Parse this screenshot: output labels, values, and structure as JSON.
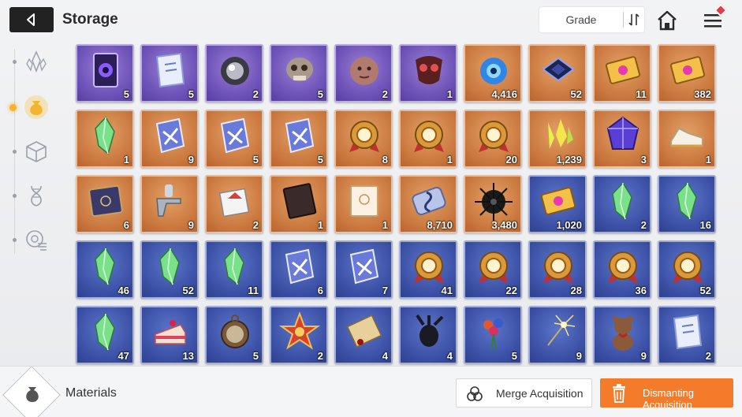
{
  "header": {
    "title": "Storage",
    "sort_label": "Grade"
  },
  "sidebar": {
    "items": [
      {
        "icon": "crystal-icon",
        "active": false
      },
      {
        "icon": "pouch-icon",
        "active": true
      },
      {
        "icon": "cube-icon",
        "active": false
      },
      {
        "icon": "dna-icon",
        "active": false
      },
      {
        "icon": "disc-icon",
        "active": false
      }
    ]
  },
  "colors": {
    "purple_rarity": "#6a4fb5",
    "orange_rarity": "#c9773d",
    "blue_rarity": "#3a4fa3",
    "dismantle_button": "#f47b29",
    "badge": "#e53b47"
  },
  "items": [
    {
      "rarity": "purple",
      "icon": "card-icon",
      "qty": "5"
    },
    {
      "rarity": "purple",
      "icon": "book-icon",
      "qty": "5"
    },
    {
      "rarity": "purple",
      "icon": "orb-icon",
      "qty": "2"
    },
    {
      "rarity": "purple",
      "icon": "skull-icon",
      "qty": "5"
    },
    {
      "rarity": "purple",
      "icon": "head-icon",
      "qty": "2"
    },
    {
      "rarity": "purple",
      "icon": "mask-icon",
      "qty": "1"
    },
    {
      "rarity": "orange",
      "icon": "blue-core-icon",
      "qty": "4,416"
    },
    {
      "rarity": "orange",
      "icon": "chip-icon",
      "qty": "52"
    },
    {
      "rarity": "orange",
      "icon": "ticket-icon",
      "qty": "11"
    },
    {
      "rarity": "orange",
      "icon": "ticket-icon",
      "qty": "382"
    },
    {
      "rarity": "orange",
      "icon": "crystal-icon",
      "qty": "1"
    },
    {
      "rarity": "orange",
      "icon": "manual-icon",
      "qty": "9"
    },
    {
      "rarity": "orange",
      "icon": "manual-icon",
      "qty": "5"
    },
    {
      "rarity": "orange",
      "icon": "manual-icon",
      "qty": "5"
    },
    {
      "rarity": "orange",
      "icon": "medal-icon",
      "qty": "8"
    },
    {
      "rarity": "orange",
      "icon": "medal-icon",
      "qty": "1"
    },
    {
      "rarity": "orange",
      "icon": "medal-icon",
      "qty": "20"
    },
    {
      "rarity": "orange",
      "icon": "shard-icon",
      "qty": "1,239"
    },
    {
      "rarity": "orange",
      "icon": "cube-gem-icon",
      "qty": "3"
    },
    {
      "rarity": "orange",
      "icon": "sneaker-icon",
      "qty": "1"
    },
    {
      "rarity": "orange",
      "icon": "tome-icon",
      "qty": "6"
    },
    {
      "rarity": "orange",
      "icon": "spray-gun-icon",
      "qty": "9"
    },
    {
      "rarity": "orange",
      "icon": "papers-icon",
      "qty": "2"
    },
    {
      "rarity": "orange",
      "icon": "ledger-icon",
      "qty": "1"
    },
    {
      "rarity": "orange",
      "icon": "notebook-icon",
      "qty": "1"
    },
    {
      "rarity": "orange",
      "icon": "music-scroll-icon",
      "qty": "8,710"
    },
    {
      "rarity": "orange",
      "icon": "urchin-icon",
      "qty": "3,480"
    },
    {
      "rarity": "blue",
      "icon": "ticket-icon",
      "qty": "1,020"
    },
    {
      "rarity": "blue",
      "icon": "crystal-icon",
      "qty": "2"
    },
    {
      "rarity": "blue",
      "icon": "crystal-icon",
      "qty": "16"
    },
    {
      "rarity": "blue",
      "icon": "crystal-icon",
      "qty": "46"
    },
    {
      "rarity": "blue",
      "icon": "crystal-icon",
      "qty": "52"
    },
    {
      "rarity": "blue",
      "icon": "crystal-icon",
      "qty": "11"
    },
    {
      "rarity": "blue",
      "icon": "manual-icon",
      "qty": "6"
    },
    {
      "rarity": "blue",
      "icon": "manual-icon",
      "qty": "7"
    },
    {
      "rarity": "blue",
      "icon": "medal-icon",
      "qty": "41"
    },
    {
      "rarity": "blue",
      "icon": "medal-icon",
      "qty": "22"
    },
    {
      "rarity": "blue",
      "icon": "medal-icon",
      "qty": "28"
    },
    {
      "rarity": "blue",
      "icon": "medal-icon",
      "qty": "36"
    },
    {
      "rarity": "blue",
      "icon": "medal-icon",
      "qty": "52"
    },
    {
      "rarity": "blue",
      "icon": "crystal-icon",
      "qty": "47"
    },
    {
      "rarity": "blue",
      "icon": "cake-icon",
      "qty": "13"
    },
    {
      "rarity": "blue",
      "icon": "pocket-watch-icon",
      "qty": "5"
    },
    {
      "rarity": "blue",
      "icon": "star-badge-icon",
      "qty": "2"
    },
    {
      "rarity": "blue",
      "icon": "letter-icon",
      "qty": "4"
    },
    {
      "rarity": "blue",
      "icon": "beetle-icon",
      "qty": "4"
    },
    {
      "rarity": "blue",
      "icon": "bouquet-icon",
      "qty": "5"
    },
    {
      "rarity": "blue",
      "icon": "sparkler-icon",
      "qty": "9"
    },
    {
      "rarity": "blue",
      "icon": "teddy-bear-icon",
      "qty": "9"
    },
    {
      "rarity": "blue",
      "icon": "book-icon",
      "qty": "2"
    }
  ],
  "footer": {
    "category_label": "Materials",
    "merge_label": "Merge Acquisition",
    "dismantle_label": "Dismanting Acquisition"
  }
}
